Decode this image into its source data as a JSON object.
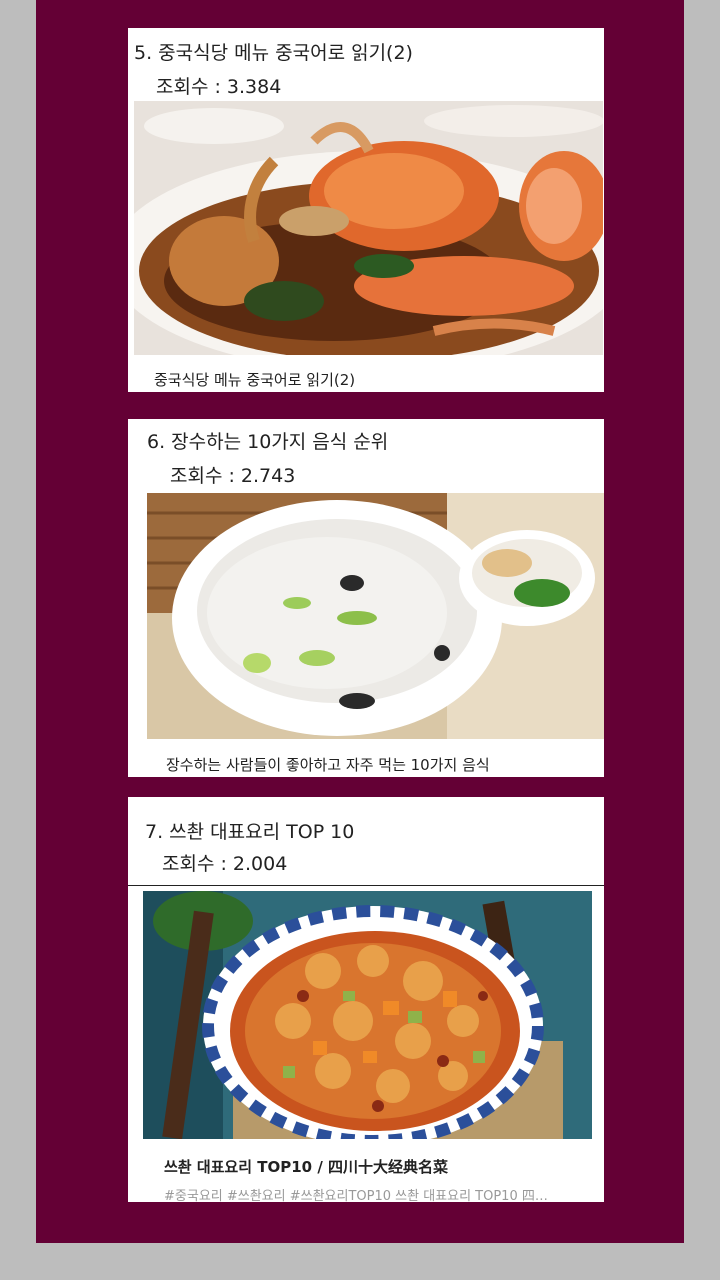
{
  "posts": [
    {
      "title": "5. 중국식당 메뉴 중국어로 읽기(2)",
      "views": "조회수 : 3.384",
      "image": "crab-dish-photo",
      "caption": "중국식당 메뉴 중국어로 읽기(2)"
    },
    {
      "title": "6. 장수하는 10가지 음식 순위",
      "views": "조회수 : 2.743",
      "image": "congee-bowl-photo",
      "caption": "장수하는 사람들이 좋아하고 자주 먹는 10가지 음식"
    },
    {
      "title": "7. 쓰촨 대표요리 TOP 10",
      "views": "조회수 : 2.004",
      "image": "kung-pao-chicken-photo",
      "caption": "쓰촨 대표요리 TOP10 / 四川十大经典名菜",
      "tags": "#중국요리 #쓰촨요리 #쓰촨요리TOP10 쓰촨 대표요리 TOP10 四…"
    }
  ],
  "colors": {
    "page_background": "#640035",
    "outer_background": "#bdbdbd",
    "card_background": "#ffffff"
  }
}
